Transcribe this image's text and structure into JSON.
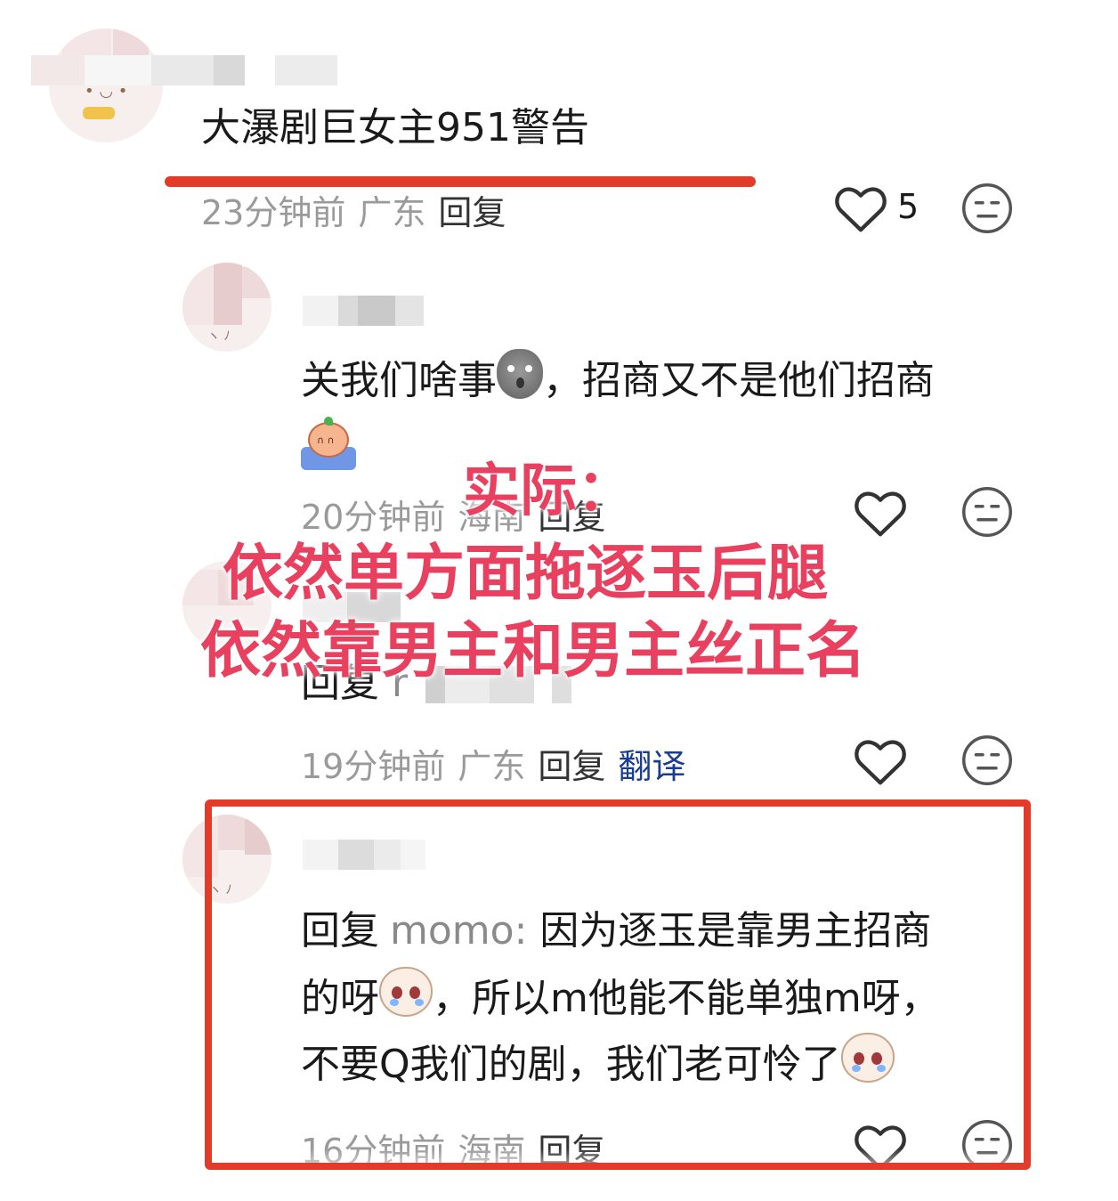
{
  "comments": [
    {
      "text": "大瀑剧巨女主951警告",
      "time": "23分钟前",
      "region": "广东",
      "reply_label": "回复",
      "likes": "5"
    },
    {
      "text_line1": "关我们啥事",
      "text_line1b": "，招商又不是他们招商",
      "time": "20分钟前",
      "region": "海南",
      "reply_label": "回复"
    },
    {
      "reply_prefix": "回复",
      "mention_fragment": "r",
      "time": "19分钟前",
      "region": "广东",
      "reply_label": "回复",
      "translate_label": "翻译"
    },
    {
      "reply_prefix": "回复",
      "mention": "momo:",
      "line1": " 因为逐玉是靠男主招商",
      "line2a": "的呀",
      "line2b": "，所以m他能不能单独m呀，",
      "line3": "不要Q我们的剧，我们老可怜了",
      "time": "16分钟前",
      "region": "海南",
      "reply_label": "回复"
    }
  ],
  "annotation": {
    "title": "实际：",
    "line1": "依然单方面拖逐玉后腿",
    "line2": "依然靠男主和男主丝正名"
  },
  "icons": {
    "like": "heart-outline-icon",
    "dislike": "neutral-face-icon",
    "emoji_1": "sad-potato-emoji",
    "emoji_2": "crying-peach-emoji",
    "emoji_3": "teary-cat-emoji"
  },
  "colors": {
    "highlight_red": "#e23b2a",
    "annotation_pink": "#e8405e",
    "translate_blue": "#1a3d8f"
  }
}
